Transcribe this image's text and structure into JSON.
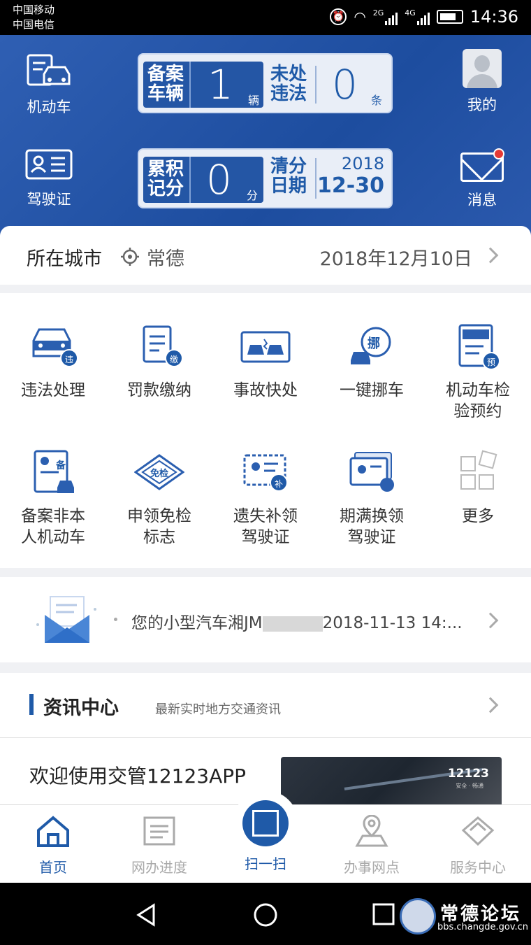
{
  "status_bar": {
    "carrier1": "中国移动",
    "carrier2": "中国电信",
    "net1": "2G",
    "net2": "4G",
    "time": "14:36"
  },
  "header": {
    "vehicle_label": "机动车",
    "license_label": "驾驶证",
    "me_label": "我的",
    "message_label": "消息",
    "card1": {
      "registered_label_l1": "备案",
      "registered_label_l2": "车辆",
      "registered_count": "1",
      "registered_unit": "辆",
      "violation_label_l1": "未处",
      "violation_label_l2": "违法",
      "violation_count": "0",
      "violation_unit": "条"
    },
    "card2": {
      "points_label_l1": "累积",
      "points_label_l2": "记分",
      "points_value": "0",
      "points_unit": "分",
      "clear_label_l1": "清分",
      "clear_label_l2": "日期",
      "clear_year": "2018",
      "clear_date": "12-30"
    }
  },
  "city_bar": {
    "label": "所在城市",
    "city": "常德",
    "date": "2018年12月10日"
  },
  "services": [
    {
      "l1": "违法处理",
      "l2": "",
      "badge": "违"
    },
    {
      "l1": "罚款缴纳",
      "l2": "",
      "badge": "缴"
    },
    {
      "l1": "事故快处",
      "l2": "",
      "badge": ""
    },
    {
      "l1": "一键挪车",
      "l2": "",
      "badge": "挪"
    },
    {
      "l1": "机动车检",
      "l2": "验预约",
      "badge": "预"
    },
    {
      "l1": "备案非本",
      "l2": "人机动车",
      "badge": "备"
    },
    {
      "l1": "申领免检",
      "l2": "标志",
      "badge": "免检"
    },
    {
      "l1": "遗失补领",
      "l2": "驾驶证",
      "badge": "补"
    },
    {
      "l1": "期满换领",
      "l2": "驾驶证",
      "badge": ""
    },
    {
      "l1": "更多",
      "l2": "",
      "badge": ""
    }
  ],
  "message": {
    "text_prefix": "您的小型汽车湘JM",
    "text_suffix": "2018-11-13 14:..."
  },
  "news": {
    "title": "资讯中心",
    "subtitle": "最新实时地方交通资讯",
    "item": "欢迎使用交管12123APP",
    "image_logo": "12123",
    "image_tag": "安全 · 畅通"
  },
  "tabs": [
    {
      "label": "首页"
    },
    {
      "label": "网办进度"
    },
    {
      "label": "扫一扫"
    },
    {
      "label": "办事网点"
    },
    {
      "label": "服务中心"
    }
  ],
  "watermark": {
    "title": "常德论坛",
    "url": "bbs.changde.gov.cn"
  },
  "colors": {
    "primary": "#1f5aa8",
    "header_bg": "#2456a5",
    "badge_red": "#e53935"
  }
}
